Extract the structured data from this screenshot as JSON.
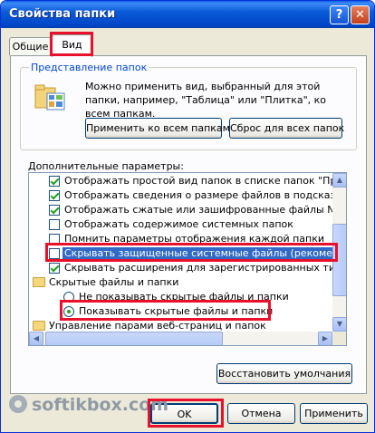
{
  "window": {
    "title": "Свойства папки",
    "help_glyph": "?",
    "close_glyph": "✕"
  },
  "tabs": [
    {
      "label": "Общие",
      "active": false
    },
    {
      "label": "Вид",
      "active": true
    }
  ],
  "folder_view": {
    "group_label": "Представление папок",
    "description": "Можно применить вид, выбранный для этой папки, например, \"Таблица\" или \"Плитка\", ко всем папкам.",
    "apply_all_label": "Применить ко всем папкам",
    "reset_all_label": "Сброс для всех папок"
  },
  "advanced": {
    "label": "Дополнительные параметры:",
    "items": [
      {
        "kind": "checkbox",
        "checked": true,
        "text": "Отображать простой вид папок в списке папок \"Проводни"
      },
      {
        "kind": "checkbox",
        "checked": true,
        "text": "Отображать сведения о размере файлов в подсказках па"
      },
      {
        "kind": "checkbox",
        "checked": true,
        "text": "Отображать сжатые или зашифрованные файлы NTFS др"
      },
      {
        "kind": "checkbox",
        "checked": false,
        "text": "Отображать содержимое системных папок"
      },
      {
        "kind": "checkbox",
        "checked": false,
        "text": "Помнить параметры отображения каждой папки"
      },
      {
        "kind": "checkbox",
        "checked": false,
        "text": "Скрывать защищенные системные файлы (рекомендуетс"
      },
      {
        "kind": "checkbox",
        "checked": true,
        "text": "Скрывать расширения для зарегистрированных типов фа"
      },
      {
        "kind": "folder",
        "text": "Скрытые файлы и папки"
      },
      {
        "kind": "radio",
        "checked": false,
        "text": "Не показывать скрытые файлы и папки"
      },
      {
        "kind": "radio",
        "checked": true,
        "text": "Показывать скрытые файлы и папки"
      },
      {
        "kind": "folder",
        "text": "Управление парами веб-страниц и папок"
      }
    ]
  },
  "scrollbar_glyphs": {
    "up": "▲",
    "down": "▼",
    "left": "◀",
    "right": "▶"
  },
  "buttons": {
    "restore_defaults": "Восстановить умолчания",
    "ok": "OK",
    "cancel": "Отмена",
    "apply": "Применить"
  },
  "watermark": {
    "text": "softikbox.com"
  },
  "colors": {
    "titlebar": "#0b5bd8",
    "highlight_frame": "#e8102a",
    "selection": "#316ac5",
    "group_label": "#0046d5"
  }
}
